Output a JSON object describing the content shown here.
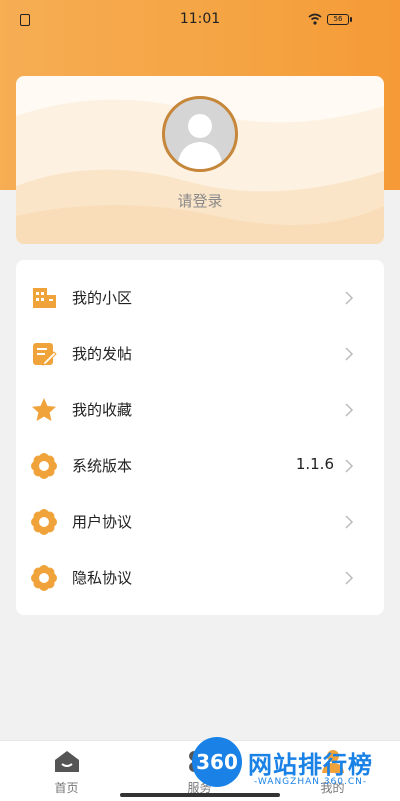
{
  "status_bar": {
    "time": "11:01",
    "battery": "56"
  },
  "profile": {
    "login_text": "请登录"
  },
  "menu": [
    {
      "label": "我的小区",
      "value": "",
      "icon": "building-icon"
    },
    {
      "label": "我的发帖",
      "value": "",
      "icon": "edit-post-icon"
    },
    {
      "label": "我的收藏",
      "value": "",
      "icon": "star-icon"
    },
    {
      "label": "系统版本",
      "value": "1.1.6",
      "icon": "flower-gear-icon"
    },
    {
      "label": "用户协议",
      "value": "",
      "icon": "flower-gear-icon"
    },
    {
      "label": "隐私协议",
      "value": "",
      "icon": "flower-gear-icon"
    }
  ],
  "tabs": [
    {
      "label": "首页",
      "icon": "home-icon"
    },
    {
      "label": "服务",
      "icon": "service-icon"
    },
    {
      "label": "我的",
      "icon": "profile-icon"
    }
  ],
  "watermark": {
    "circle": "360",
    "title": "网站排行榜",
    "url": "-WANGZHAN.360.CN-"
  },
  "colors": {
    "accent": "#f5a443",
    "icon": "#f0a33a",
    "avatar_ring": "#c6873a"
  }
}
